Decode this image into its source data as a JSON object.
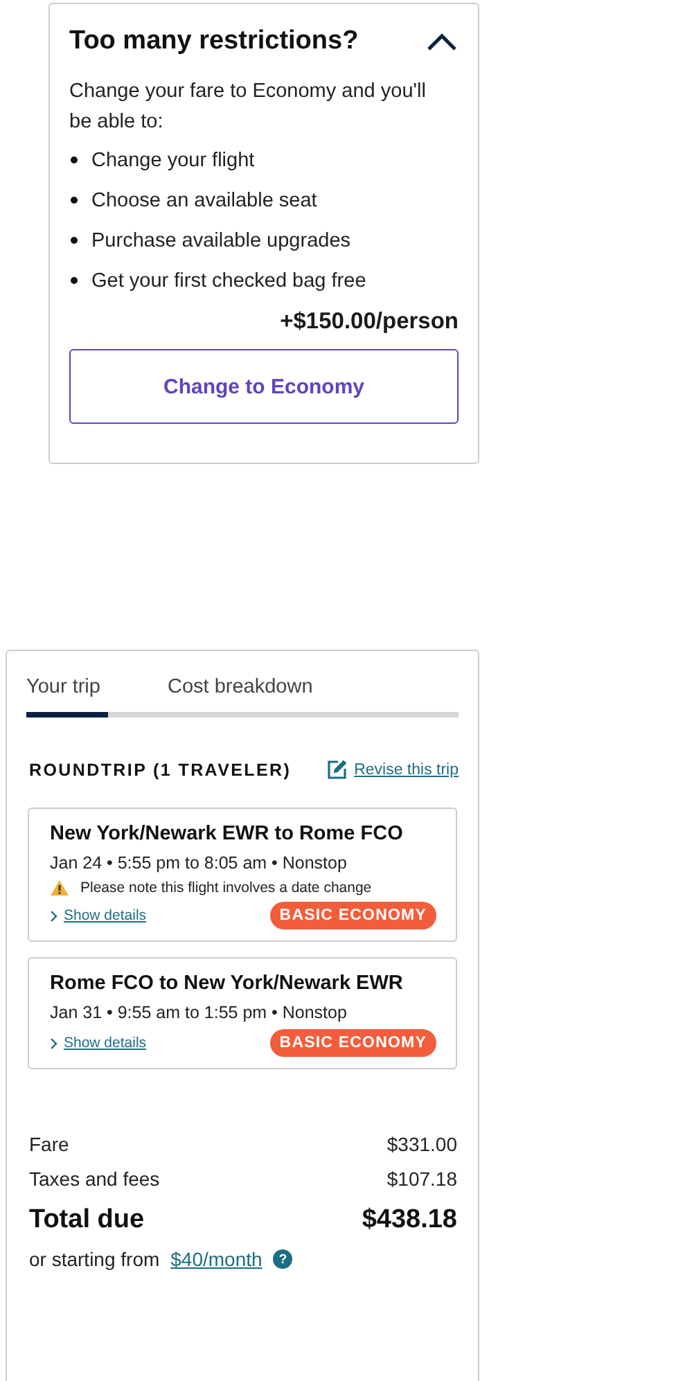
{
  "upsell": {
    "title": "Too many restrictions?",
    "expanded": true,
    "intro": "Change your fare to Economy and you'll be able to:",
    "benefits": [
      "Change your flight",
      "Choose an available seat",
      "Purchase available upgrades",
      "Get your first checked bag free"
    ],
    "price": "+$150.00/person",
    "button": "Change to Economy"
  },
  "trip": {
    "tabs": [
      {
        "label": "Your trip",
        "selected": true
      },
      {
        "label": "Cost breakdown",
        "selected": false
      }
    ],
    "heading": "ROUNDTRIP (1 TRAVELER)",
    "revise_link": "Revise this trip",
    "flights": [
      {
        "route": "New York/Newark EWR to Rome FCO",
        "schedule": "Jan 24 • 5:55 pm to 8:05 am • Nonstop",
        "warning": "Please note this flight involves a date change",
        "details_link": "Show details",
        "fare_badge": "BASIC ECONOMY"
      },
      {
        "route": "Rome FCO to New York/Newark EWR",
        "schedule": "Jan 31 • 9:55 am to 1:55 pm • Nonstop",
        "details_link": "Show details",
        "fare_badge": "BASIC ECONOMY"
      }
    ],
    "costs": [
      {
        "label": "Fare",
        "amount": "$331.00"
      },
      {
        "label": "Taxes and fees",
        "amount": "$107.18"
      }
    ],
    "total": {
      "label": "Total due",
      "amount": "$438.18"
    },
    "financing": {
      "text": "or starting from",
      "link": "$40/month",
      "help": "?"
    }
  }
}
